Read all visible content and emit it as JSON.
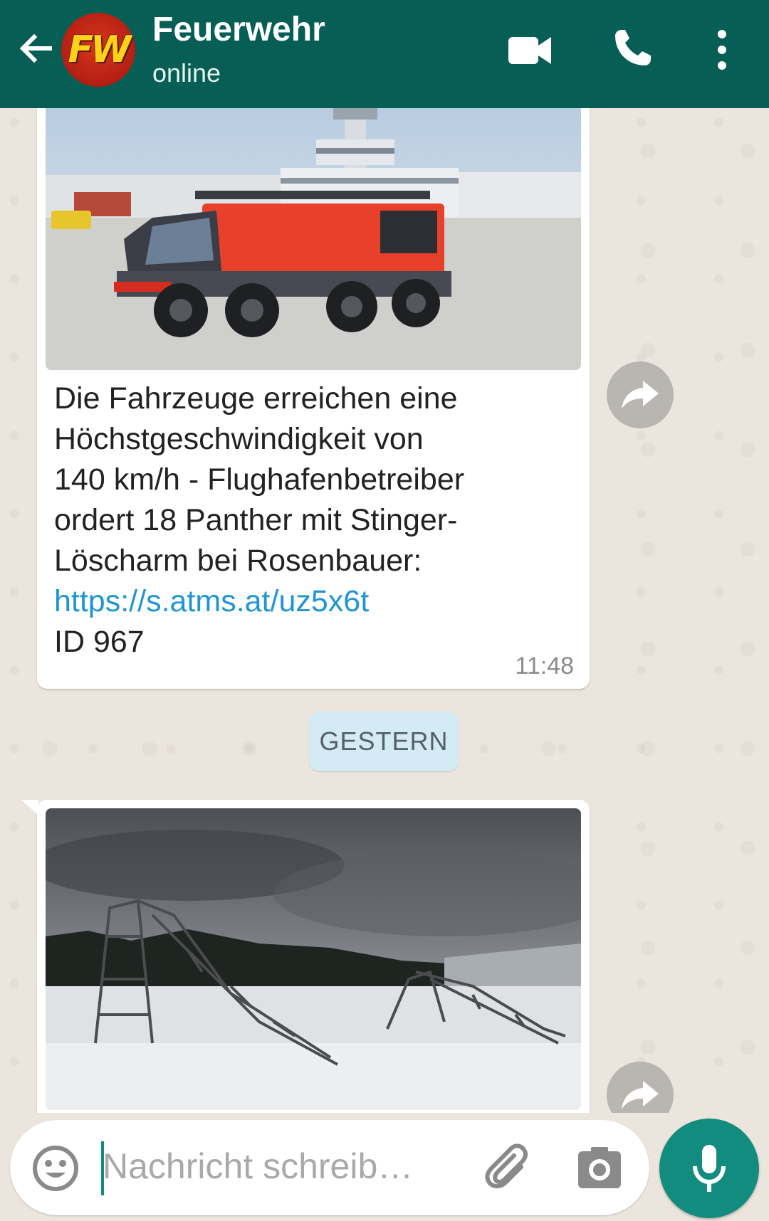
{
  "header": {
    "avatar_text": "FW",
    "title": "Feuerwehr",
    "status": "online",
    "icons": [
      "back-arrow-icon",
      "video-call-icon",
      "phone-icon",
      "more-vert-icon"
    ]
  },
  "messages": [
    {
      "image": "airport-fire-truck-photo",
      "text_lines": [
        "Die Fahrzeuge erreichen eine",
        "Höchstgeschwindigkeit von",
        "140 km/h - Flughafenbetreiber",
        "ordert 18 Panther mit Stinger-",
        "Löscharm bei Rosenbauer:"
      ],
      "link": "https://s.atms.at/uz5x6t",
      "id_line": "ID 967",
      "time": "11:48"
    },
    {
      "image": "collapsed-power-pylons-winter-photo"
    }
  ],
  "date_separator": "GESTERN",
  "input": {
    "placeholder": "Nachricht schreib…",
    "icons": [
      "emoji-icon",
      "attach-icon",
      "camera-icon",
      "mic-icon"
    ]
  },
  "colors": {
    "header": "#075e54",
    "accent": "#128c7e",
    "link": "#1f95d6",
    "chat_bg": "#ece5dd"
  }
}
